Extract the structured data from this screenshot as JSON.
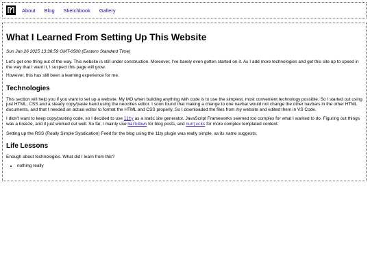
{
  "nav": {
    "logo_icon": "site-logo-icon",
    "items": [
      {
        "label": "About"
      },
      {
        "label": "Blog"
      },
      {
        "label": "Sketchbook"
      },
      {
        "label": "Gallery"
      }
    ]
  },
  "post": {
    "title": "What I Learned From Setting Up This Website",
    "date": "Sun Jan 26 2025 13:38:59 GMT-0500 (Eastern Standard Time)",
    "intro_1": "Let's get one thing out of the way. This website is still under construction. Moreover, I've barely even gotten started on it. As I add more technologies and get this site up to speed in the way that I want it, I suspect this page will grow.",
    "intro_2": "However, this has still been a learning experience for me.",
    "tech_heading": "Technologies",
    "tech_p1": "This section will help you if you want to set up a website. My MO when building anything with code is to use the simplest, most convenient technology possible. So I started out using just HTML, CSS and a steady copy/paste hand using the neocities editor. I soon found that making a change to one navbar would not change the other navbars in the other HTML documents, and that I needed an actual editor to format the HTML and CSS properly. So I downloaded the files from my website and edited them in VS Code.",
    "tech_p2": {
      "part1": "I didn't want to keep copy/pasting code, so I decided to use ",
      "link1": "11ty",
      "part2": " as a static site generator. JavaScript Frameworks seemed too complex for what I wanted to do. Figuring out things was a breeze, and it just worked out well. So far, I mainly use ",
      "link2": "markdown",
      "part3": " for blog posts, and ",
      "link3": "nunjucks",
      "part4": " for more complex templated content."
    },
    "tech_p3": "Setting up the RSS (Really Simple Syndication) Feed for the blog using the 11ty plugin was really simple, as its name suggests.",
    "life_heading": "Life Lessons",
    "life_p1": "Enough about technologies. What did I learn from this?",
    "life_items": [
      "nothing really"
    ]
  },
  "colors": {
    "link": "#1a0dab",
    "border": "#555555",
    "text": "#000000"
  }
}
